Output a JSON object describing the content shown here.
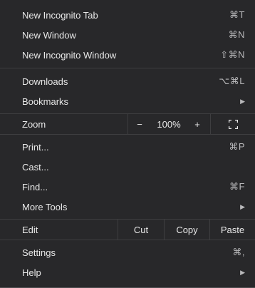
{
  "group1": [
    {
      "label": "New Incognito Tab",
      "shortcut": "⌘T"
    },
    {
      "label": "New Window",
      "shortcut": "⌘N"
    },
    {
      "label": "New Incognito Window",
      "shortcut": "⇧⌘N"
    }
  ],
  "group2": [
    {
      "label": "Downloads",
      "shortcut": "⌥⌘L"
    },
    {
      "label": "Bookmarks",
      "submenu": "▶"
    }
  ],
  "zoom": {
    "label": "Zoom",
    "minus": "−",
    "level": "100%",
    "plus": "+",
    "fullscreen_icon": "fullscreen-icon"
  },
  "group3": [
    {
      "label": "Print...",
      "shortcut": "⌘P"
    },
    {
      "label": "Cast..."
    },
    {
      "label": "Find...",
      "shortcut": "⌘F"
    },
    {
      "label": "More Tools",
      "submenu": "▶"
    }
  ],
  "edit": {
    "label": "Edit",
    "cut": "Cut",
    "copy": "Copy",
    "paste": "Paste"
  },
  "group4": [
    {
      "label": "Settings",
      "shortcut": "⌘,"
    },
    {
      "label": "Help",
      "submenu": "▶"
    }
  ]
}
